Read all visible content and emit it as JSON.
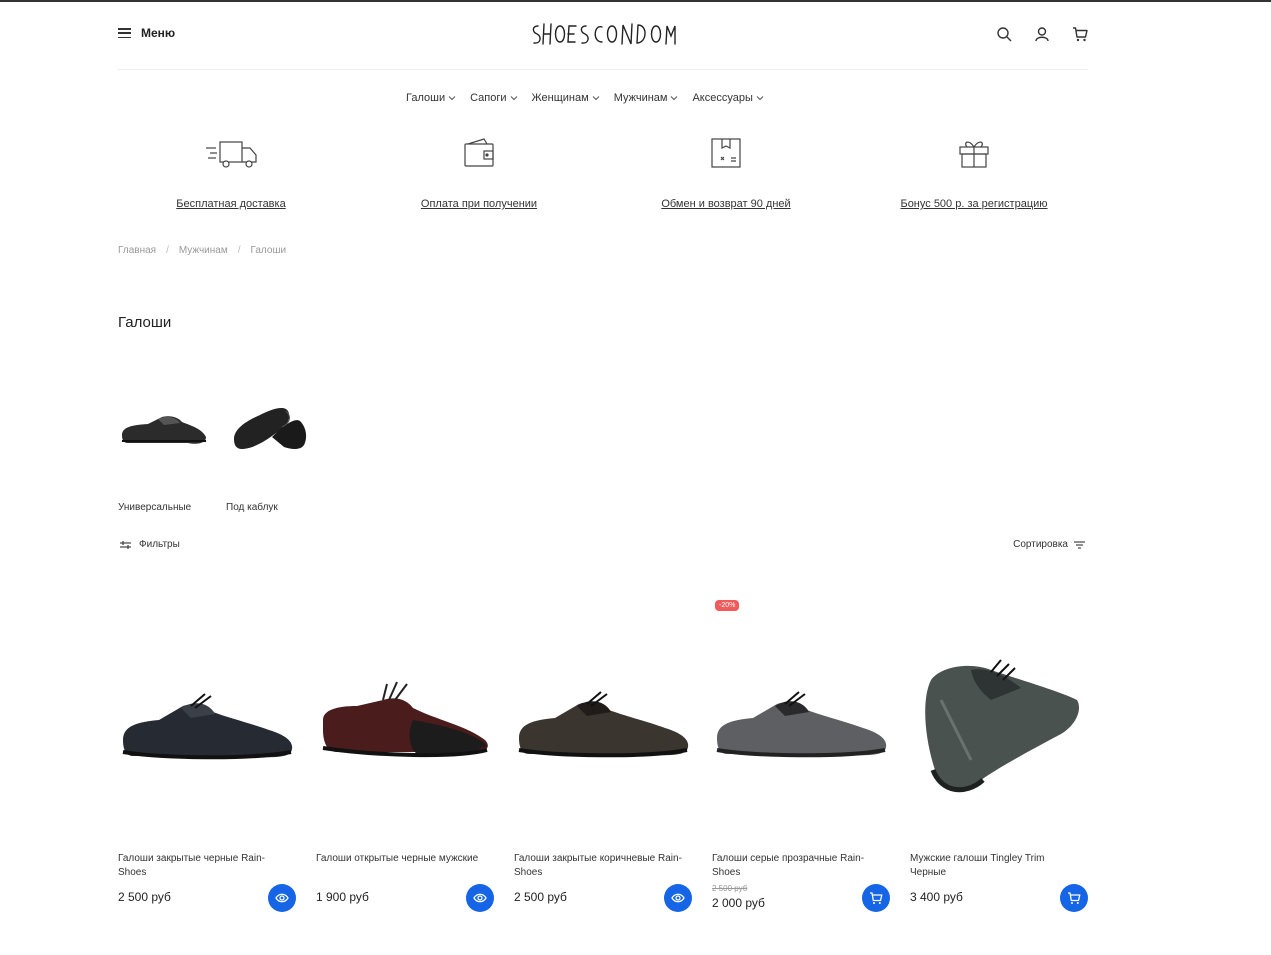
{
  "header": {
    "menu_label": "Меню",
    "logo_text": "SHOESCONDOM",
    "icons": [
      "search-icon",
      "user-icon",
      "cart-icon"
    ]
  },
  "nav": {
    "items": [
      {
        "label": "Галоши"
      },
      {
        "label": "Сапоги"
      },
      {
        "label": "Женщинам"
      },
      {
        "label": "Мужчинам"
      },
      {
        "label": "Аксессуары"
      }
    ]
  },
  "benefits": [
    {
      "label": "Бесплатная доставка",
      "icon": "truck-icon"
    },
    {
      "label": "Оплата при получении",
      "icon": "wallet-icon"
    },
    {
      "label": "Обмен и возврат 90 дней",
      "icon": "box-icon"
    },
    {
      "label": "Бонус 500 р. за регистрацию",
      "icon": "gift-icon"
    }
  ],
  "breadcrumb": {
    "items": [
      "Главная",
      "Мужчинам",
      "Галоши"
    ],
    "separator": "/"
  },
  "page": {
    "title": "Галоши"
  },
  "subcategories": [
    {
      "label": "Универсальные"
    },
    {
      "label": "Под каблук"
    }
  ],
  "toolbar": {
    "filters_label": "Фильтры",
    "sort_label": "Сортировка"
  },
  "colors": {
    "accent": "#1565e6",
    "badge": "#f05a5a"
  },
  "products": [
    {
      "name": "Галоши закрытые черные Rain-Shoes",
      "price": "2 500 руб",
      "action": "eye-icon"
    },
    {
      "name": "Галоши открытые черные мужские",
      "price": "1 900 руб",
      "action": "eye-icon"
    },
    {
      "name": "Галоши закрытые коричневые Rain-Shoes",
      "price": "2 500 руб",
      "action": "eye-icon"
    },
    {
      "name": "Галоши серые прозрачные Rain-Shoes",
      "old_price": "2 500 руб",
      "price": "2 000 руб",
      "badge": "-20%",
      "action": "cart-icon"
    },
    {
      "name": "Мужские галоши Tingley Trim Черные",
      "price": "3 400 руб",
      "action": "cart-icon"
    }
  ]
}
